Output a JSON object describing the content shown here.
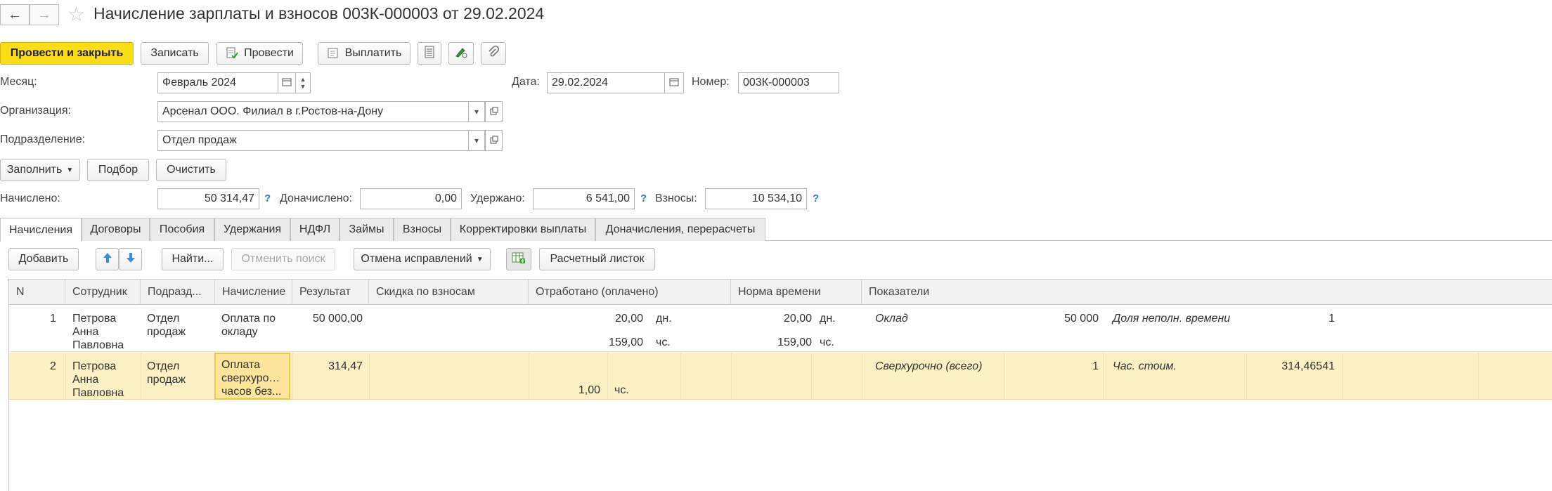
{
  "window": {
    "title": "Начисление зарплаты и взносов 003К-000003 от 29.02.2024"
  },
  "toolbar": {
    "post_close": "Провести и закрыть",
    "save": "Записать",
    "post": "Провести",
    "pay": "Выплатить"
  },
  "form": {
    "month_label": "Месяц:",
    "month_value": "Февраль 2024",
    "date_label": "Дата:",
    "date_value": "29.02.2024",
    "number_label": "Номер:",
    "number_value": "003К-000003",
    "org_label": "Организация:",
    "org_value": "Арсенал ООО. Филиал в г.Ростов-на-Дону",
    "dept_label": "Подразделение:",
    "dept_value": "Отдел продаж"
  },
  "fill_bar": {
    "fill": "Заполнить",
    "pick": "Подбор",
    "clear": "Очистить"
  },
  "totals": {
    "accrued_label": "Начислено:",
    "accrued_value": "50 314,47",
    "extra_label": "Доначислено:",
    "extra_value": "0,00",
    "withheld_label": "Удержано:",
    "withheld_value": "6 541,00",
    "contrib_label": "Взносы:",
    "contrib_value": "10 534,10",
    "help": "?"
  },
  "tabs": [
    "Начисления",
    "Договоры",
    "Пособия",
    "Удержания",
    "НДФЛ",
    "Займы",
    "Взносы",
    "Корректировки выплаты",
    "Доначисления, перерасчеты"
  ],
  "table_toolbar": {
    "add": "Добавить",
    "find": "Найти...",
    "cancel_search": "Отменить поиск",
    "cancel_fix": "Отмена исправлений",
    "payslip": "Расчетный листок"
  },
  "table": {
    "headers": [
      "N",
      "Сотрудник",
      "Подразд...",
      "Начисление",
      "Результат",
      "Скидка по взносам",
      "Отработано (оплачено)",
      "Норма времени",
      "Показатели"
    ],
    "rows": [
      {
        "n": "1",
        "employee": [
          "Петрова",
          "Анна",
          "Павловна"
        ],
        "dept": [
          "Отдел",
          "продаж"
        ],
        "accrual": [
          "Оплата по",
          "окладу"
        ],
        "result": "50 000,00",
        "worked_days": "20,00",
        "worked_days_unit": "дн.",
        "worked_hours": "159,00",
        "worked_hours_unit": "чс.",
        "norm_days": "20,00",
        "norm_days_unit": "дн.",
        "norm_hours": "159,00",
        "norm_hours_unit": "чс.",
        "ind1_name": "Оклад",
        "ind1_value": "50 000",
        "ind2_name": "Доля неполн. времени",
        "ind2_value": "1"
      },
      {
        "n": "2",
        "employee": [
          "Петрова",
          "Анна",
          "Павловна"
        ],
        "dept": [
          "Отдел",
          "продаж"
        ],
        "accrual": [
          "Оплата",
          "сверхуроч...",
          "часов без..."
        ],
        "result": "314,47",
        "worked_hours": "1,00",
        "worked_hours_unit": "чс.",
        "ind1_name": "Сверхурочно (всего)",
        "ind1_value": "1",
        "ind2_name": "Час. стоим.",
        "ind2_value": "314,46541"
      }
    ]
  }
}
